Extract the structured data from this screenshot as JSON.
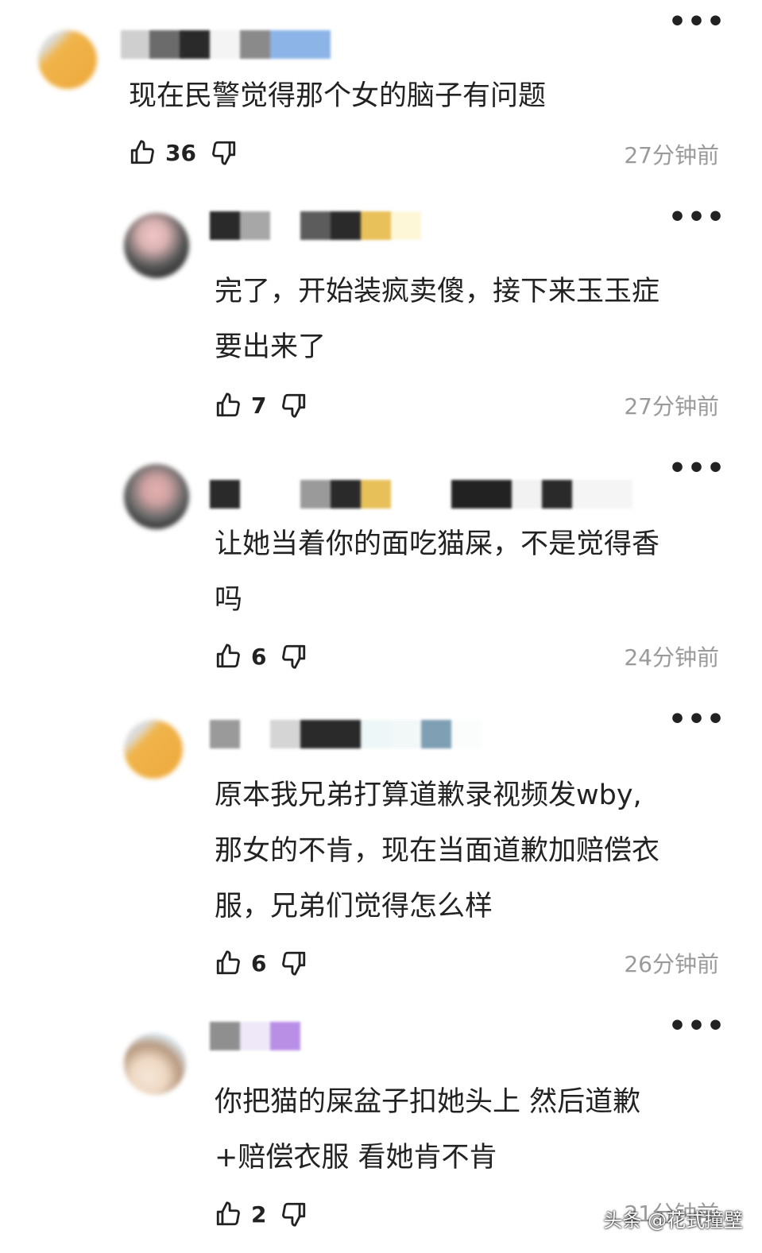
{
  "comments": [
    {
      "text_lines": [
        "现在民警觉得那个女的脑子有问题"
      ],
      "likes": "36",
      "time": "27分钟前"
    },
    {
      "text_lines": [
        "完了，开始装疯卖傻，接下来玉玉症",
        "要出来了"
      ],
      "likes": "7",
      "time": "27分钟前"
    },
    {
      "text_lines": [
        "让她当着你的面吃猫屎，不是觉得香",
        "吗"
      ],
      "likes": "6",
      "time": "24分钟前"
    },
    {
      "text_lines": [
        "原本我兄弟打算道歉录视频发wby,",
        "那女的不肯，现在当面道歉加赔偿衣",
        "服，兄弟们觉得怎么样"
      ],
      "likes": "6",
      "time": "26分钟前"
    },
    {
      "text_lines": [
        "你把猫的屎盆子扣她头上 然后道歉",
        "+赔偿衣服 看她肯不肯"
      ],
      "likes": "2",
      "time": "21分钟前"
    }
  ],
  "more_label": "•••",
  "watermark": "头条 @花式撞壁",
  "icons": {
    "like": "thumbs-up-icon",
    "dislike": "thumbs-down-icon",
    "more": "more-dots-icon"
  }
}
